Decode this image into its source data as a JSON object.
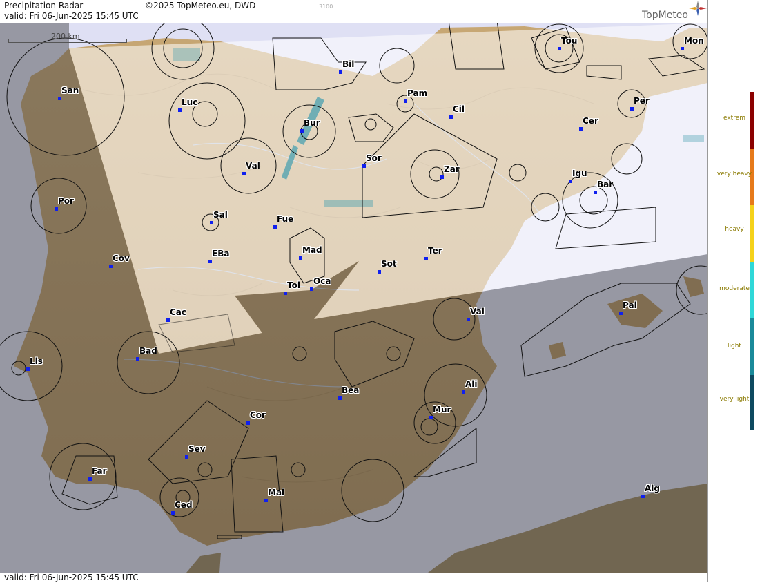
{
  "header": {
    "title": "Precipitation Radar",
    "copyright": "©2025 TopMeteo.eu, DWD",
    "code": "3100",
    "valid": "valid:  Fri  06-Jun-2025 15:45 UTC"
  },
  "logo": "TopMeteo",
  "footer": {
    "valid": "valid:  Fri  06-Jun-2025 15:45 UTC"
  },
  "scale_label": "200 km",
  "legend": [
    {
      "label": "extrem",
      "color": "#8b0000"
    },
    {
      "label": "very heavy",
      "color": "#e67a1a"
    },
    {
      "label": "heavy",
      "color": "#f5d21a"
    },
    {
      "label": "moderate",
      "color": "#2fd8d8"
    },
    {
      "label": "light",
      "color": "#1a8a9a"
    },
    {
      "label": "very light",
      "color": "#0e4a60"
    }
  ],
  "cities": [
    {
      "name": "Tou"
    },
    {
      "name": "Mon"
    },
    {
      "name": "Bil"
    },
    {
      "name": "San"
    },
    {
      "name": "Pam"
    },
    {
      "name": "Per"
    },
    {
      "name": "Luc"
    },
    {
      "name": "Cil"
    },
    {
      "name": "Bur"
    },
    {
      "name": "Cer"
    },
    {
      "name": "Val"
    },
    {
      "name": "Sor"
    },
    {
      "name": "Zar"
    },
    {
      "name": "Igu"
    },
    {
      "name": "Bar"
    },
    {
      "name": "Por"
    },
    {
      "name": "Sal"
    },
    {
      "name": "Fue"
    },
    {
      "name": "Mad"
    },
    {
      "name": "Cov"
    },
    {
      "name": "EBa"
    },
    {
      "name": "Ter"
    },
    {
      "name": "Sot"
    },
    {
      "name": "Oca"
    },
    {
      "name": "Tol"
    },
    {
      "name": "Pal"
    },
    {
      "name": "Cac"
    },
    {
      "name": "Val"
    },
    {
      "name": "Bad"
    },
    {
      "name": "Lis"
    },
    {
      "name": "Ali"
    },
    {
      "name": "Bea"
    },
    {
      "name": "Mur"
    },
    {
      "name": "Cor"
    },
    {
      "name": "Sev"
    },
    {
      "name": "Far"
    },
    {
      "name": "Mal"
    },
    {
      "name": "Alg"
    },
    {
      "name": "Ced"
    }
  ],
  "colors": {
    "sea": "#dfe0f4",
    "land_light": "#e6c28a",
    "land_dark": "#7b6a48",
    "overlay": "#ffffff",
    "shade": "#505050"
  }
}
